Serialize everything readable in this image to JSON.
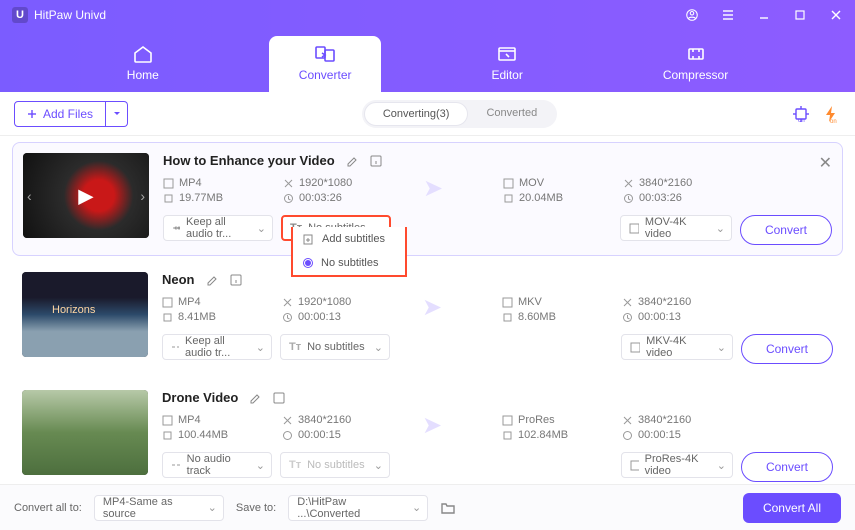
{
  "app": {
    "title": "HitPaw Univd"
  },
  "headerTabs": {
    "home": "Home",
    "converter": "Converter",
    "editor": "Editor",
    "compressor": "Compressor"
  },
  "toolbar": {
    "addFiles": "Add Files",
    "converting": "Converting(3)",
    "converted": "Converted"
  },
  "items": [
    {
      "title": "How to Enhance your Video",
      "src": {
        "fmt": "MP4",
        "res": "1920*1080",
        "size": "19.77MB",
        "dur": "00:03:26"
      },
      "dst": {
        "fmt": "MOV",
        "res": "3840*2160",
        "size": "20.04MB",
        "dur": "00:03:26"
      },
      "audio": "Keep all audio tr...",
      "sub": "No subtitles",
      "preset": "MOV-4K video",
      "convert": "Convert"
    },
    {
      "title": "Neon",
      "src": {
        "fmt": "MP4",
        "res": "1920*1080",
        "size": "8.41MB",
        "dur": "00:00:13"
      },
      "dst": {
        "fmt": "MKV",
        "res": "3840*2160",
        "size": "8.60MB",
        "dur": "00:00:13"
      },
      "audio": "Keep all audio tr...",
      "sub": "No subtitles",
      "preset": "MKV-4K video",
      "convert": "Convert"
    },
    {
      "title": "Drone Video",
      "src": {
        "fmt": "MP4",
        "res": "3840*2160",
        "size": "100.44MB",
        "dur": "00:00:15"
      },
      "dst": {
        "fmt": "ProRes",
        "res": "3840*2160",
        "size": "102.84MB",
        "dur": "00:00:15"
      },
      "audio": "No audio track",
      "sub": "No subtitles",
      "preset": "ProRes-4K video",
      "convert": "Convert"
    }
  ],
  "subtitleMenu": {
    "add": "Add subtitles",
    "none": "No subtitles"
  },
  "footer": {
    "convertAllLabel": "Convert all to:",
    "convertAllValue": "MP4-Same as source",
    "saveToLabel": "Save to:",
    "saveToValue": "D:\\HitPaw ...\\Converted",
    "convertAll": "Convert All"
  }
}
